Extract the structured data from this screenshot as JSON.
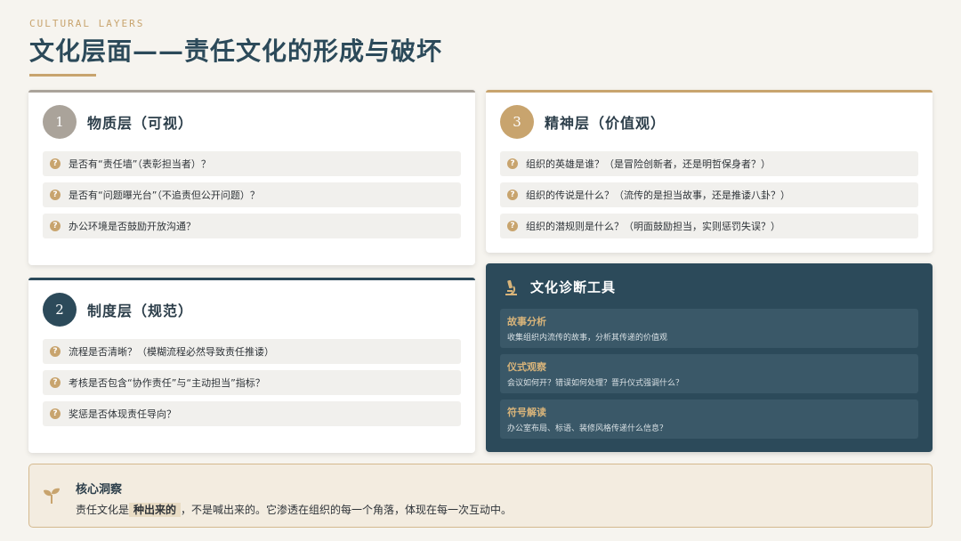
{
  "header": {
    "eyebrow": "CULTURAL LAYERS",
    "title": "文化层面——责任文化的形成与破坏"
  },
  "layers": [
    {
      "number": "1",
      "title": "物质层（可视）",
      "accent": "#aaa39a",
      "questions": [
        "是否有“责任墙”（表彰担当者）？",
        "是否有“问题曝光台”（不追责但公开问题）？",
        "办公环境是否鼓励开放沟通？"
      ]
    },
    {
      "number": "2",
      "title": "制度层（规范）",
      "accent": "#2c4a5a",
      "questions": [
        "流程是否清晰？（模糊流程必然导致责任推诿）",
        "考核是否包含“协作责任”与“主动担当”指标？",
        "奖惩是否体现责任导向？"
      ]
    },
    {
      "number": "3",
      "title": "精神层（价值观）",
      "accent": "#c8a46e",
      "questions": [
        "组织的英雄是谁？（是冒险创新者，还是明哲保身者？）",
        "组织的传说是什么？（流传的是担当故事，还是推诿八卦？）",
        "组织的潜规则是什么？（明面鼓励担当，实则惩罚失误？）"
      ]
    }
  ],
  "question_icon": "question-mark-icon",
  "tools": {
    "icon": "microscope-icon",
    "title": "文化诊断工具",
    "items": [
      {
        "name": "故事分析",
        "desc": "收集组织内流传的故事，分析其传递的价值观"
      },
      {
        "name": "仪式观察",
        "desc": "会议如何开？错误如何处理？晋升仪式强调什么？"
      },
      {
        "name": "符号解读",
        "desc": "办公室布局、标语、装修风格传递什么信息？"
      }
    ]
  },
  "insight": {
    "icon": "sprout-icon",
    "title": "核心洞察",
    "text_before": "责任文化是",
    "highlight": "种出来的",
    "text_after": "，不是喊出来的。它渗透在组织的每一个角落，体现在每一次互动中。"
  },
  "colors": {
    "gold": "#c8a46e",
    "navy": "#2c4a5a",
    "grey": "#aaa39a"
  }
}
